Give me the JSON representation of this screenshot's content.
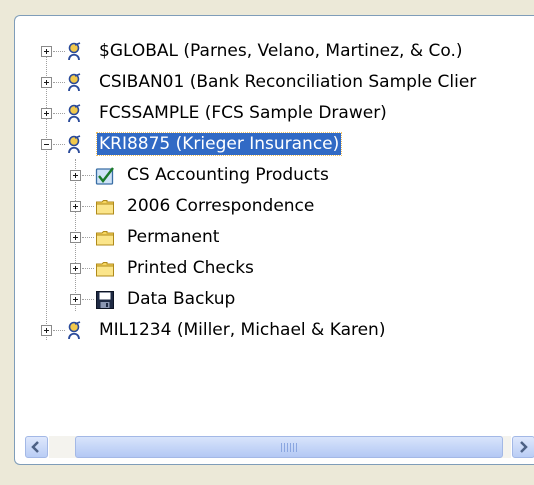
{
  "tree": {
    "nodes": [
      {
        "label": "$GLOBAL (Parnes, Velano, Martinez, & Co.)",
        "icon": "client-drawer-icon",
        "expanded": false,
        "selected": false,
        "level": 0
      },
      {
        "label": "CSIBAN01 (Bank Reconciliation Sample Clier",
        "icon": "client-drawer-icon",
        "expanded": false,
        "selected": false,
        "level": 0
      },
      {
        "label": "FCSSAMPLE (FCS Sample Drawer)",
        "icon": "client-drawer-icon",
        "expanded": false,
        "selected": false,
        "level": 0
      },
      {
        "label": "KRI8875 (Krieger Insurance)",
        "icon": "client-drawer-icon",
        "expanded": true,
        "selected": true,
        "level": 0
      },
      {
        "label": "CS Accounting Products",
        "icon": "checklist-icon",
        "expanded": false,
        "selected": false,
        "level": 1
      },
      {
        "label": "2006 Correspondence",
        "icon": "folder-icon",
        "expanded": false,
        "selected": false,
        "level": 1
      },
      {
        "label": "Permanent",
        "icon": "folder-icon",
        "expanded": false,
        "selected": false,
        "level": 1
      },
      {
        "label": "Printed Checks",
        "icon": "folder-icon",
        "expanded": false,
        "selected": false,
        "level": 1
      },
      {
        "label": "Data Backup",
        "icon": "floppy-disk-icon",
        "expanded": false,
        "selected": false,
        "level": 1
      },
      {
        "label": "MIL1234 (Miller, Michael & Karen)",
        "icon": "client-drawer-icon",
        "expanded": false,
        "selected": false,
        "level": 0
      }
    ]
  },
  "scrollbar": {
    "left_icon": "arrow-left-icon",
    "right_icon": "arrow-right-icon"
  },
  "colors": {
    "selection": "#316ac5",
    "folder": "#f7d760",
    "client_icon": "#2a4a9a"
  }
}
